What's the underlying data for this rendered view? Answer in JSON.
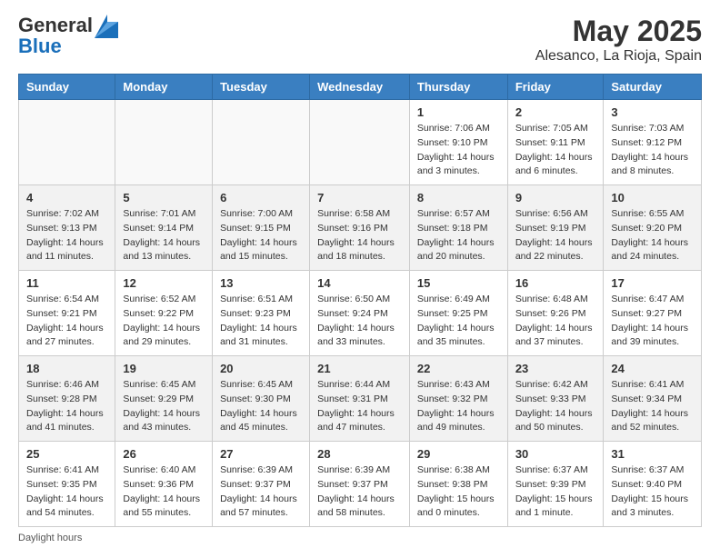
{
  "header": {
    "logo_line1": "General",
    "logo_line2": "Blue",
    "title": "May 2025",
    "subtitle": "Alesanco, La Rioja, Spain"
  },
  "days_of_week": [
    "Sunday",
    "Monday",
    "Tuesday",
    "Wednesday",
    "Thursday",
    "Friday",
    "Saturday"
  ],
  "weeks": [
    [
      {
        "day": "",
        "info": ""
      },
      {
        "day": "",
        "info": ""
      },
      {
        "day": "",
        "info": ""
      },
      {
        "day": "",
        "info": ""
      },
      {
        "day": "1",
        "info": "Sunrise: 7:06 AM\nSunset: 9:10 PM\nDaylight: 14 hours\nand 3 minutes."
      },
      {
        "day": "2",
        "info": "Sunrise: 7:05 AM\nSunset: 9:11 PM\nDaylight: 14 hours\nand 6 minutes."
      },
      {
        "day": "3",
        "info": "Sunrise: 7:03 AM\nSunset: 9:12 PM\nDaylight: 14 hours\nand 8 minutes."
      }
    ],
    [
      {
        "day": "4",
        "info": "Sunrise: 7:02 AM\nSunset: 9:13 PM\nDaylight: 14 hours\nand 11 minutes."
      },
      {
        "day": "5",
        "info": "Sunrise: 7:01 AM\nSunset: 9:14 PM\nDaylight: 14 hours\nand 13 minutes."
      },
      {
        "day": "6",
        "info": "Sunrise: 7:00 AM\nSunset: 9:15 PM\nDaylight: 14 hours\nand 15 minutes."
      },
      {
        "day": "7",
        "info": "Sunrise: 6:58 AM\nSunset: 9:16 PM\nDaylight: 14 hours\nand 18 minutes."
      },
      {
        "day": "8",
        "info": "Sunrise: 6:57 AM\nSunset: 9:18 PM\nDaylight: 14 hours\nand 20 minutes."
      },
      {
        "day": "9",
        "info": "Sunrise: 6:56 AM\nSunset: 9:19 PM\nDaylight: 14 hours\nand 22 minutes."
      },
      {
        "day": "10",
        "info": "Sunrise: 6:55 AM\nSunset: 9:20 PM\nDaylight: 14 hours\nand 24 minutes."
      }
    ],
    [
      {
        "day": "11",
        "info": "Sunrise: 6:54 AM\nSunset: 9:21 PM\nDaylight: 14 hours\nand 27 minutes."
      },
      {
        "day": "12",
        "info": "Sunrise: 6:52 AM\nSunset: 9:22 PM\nDaylight: 14 hours\nand 29 minutes."
      },
      {
        "day": "13",
        "info": "Sunrise: 6:51 AM\nSunset: 9:23 PM\nDaylight: 14 hours\nand 31 minutes."
      },
      {
        "day": "14",
        "info": "Sunrise: 6:50 AM\nSunset: 9:24 PM\nDaylight: 14 hours\nand 33 minutes."
      },
      {
        "day": "15",
        "info": "Sunrise: 6:49 AM\nSunset: 9:25 PM\nDaylight: 14 hours\nand 35 minutes."
      },
      {
        "day": "16",
        "info": "Sunrise: 6:48 AM\nSunset: 9:26 PM\nDaylight: 14 hours\nand 37 minutes."
      },
      {
        "day": "17",
        "info": "Sunrise: 6:47 AM\nSunset: 9:27 PM\nDaylight: 14 hours\nand 39 minutes."
      }
    ],
    [
      {
        "day": "18",
        "info": "Sunrise: 6:46 AM\nSunset: 9:28 PM\nDaylight: 14 hours\nand 41 minutes."
      },
      {
        "day": "19",
        "info": "Sunrise: 6:45 AM\nSunset: 9:29 PM\nDaylight: 14 hours\nand 43 minutes."
      },
      {
        "day": "20",
        "info": "Sunrise: 6:45 AM\nSunset: 9:30 PM\nDaylight: 14 hours\nand 45 minutes."
      },
      {
        "day": "21",
        "info": "Sunrise: 6:44 AM\nSunset: 9:31 PM\nDaylight: 14 hours\nand 47 minutes."
      },
      {
        "day": "22",
        "info": "Sunrise: 6:43 AM\nSunset: 9:32 PM\nDaylight: 14 hours\nand 49 minutes."
      },
      {
        "day": "23",
        "info": "Sunrise: 6:42 AM\nSunset: 9:33 PM\nDaylight: 14 hours\nand 50 minutes."
      },
      {
        "day": "24",
        "info": "Sunrise: 6:41 AM\nSunset: 9:34 PM\nDaylight: 14 hours\nand 52 minutes."
      }
    ],
    [
      {
        "day": "25",
        "info": "Sunrise: 6:41 AM\nSunset: 9:35 PM\nDaylight: 14 hours\nand 54 minutes."
      },
      {
        "day": "26",
        "info": "Sunrise: 6:40 AM\nSunset: 9:36 PM\nDaylight: 14 hours\nand 55 minutes."
      },
      {
        "day": "27",
        "info": "Sunrise: 6:39 AM\nSunset: 9:37 PM\nDaylight: 14 hours\nand 57 minutes."
      },
      {
        "day": "28",
        "info": "Sunrise: 6:39 AM\nSunset: 9:37 PM\nDaylight: 14 hours\nand 58 minutes."
      },
      {
        "day": "29",
        "info": "Sunrise: 6:38 AM\nSunset: 9:38 PM\nDaylight: 15 hours\nand 0 minutes."
      },
      {
        "day": "30",
        "info": "Sunrise: 6:37 AM\nSunset: 9:39 PM\nDaylight: 15 hours\nand 1 minute."
      },
      {
        "day": "31",
        "info": "Sunrise: 6:37 AM\nSunset: 9:40 PM\nDaylight: 15 hours\nand 3 minutes."
      }
    ]
  ],
  "footer": {
    "daylight_label": "Daylight hours"
  }
}
